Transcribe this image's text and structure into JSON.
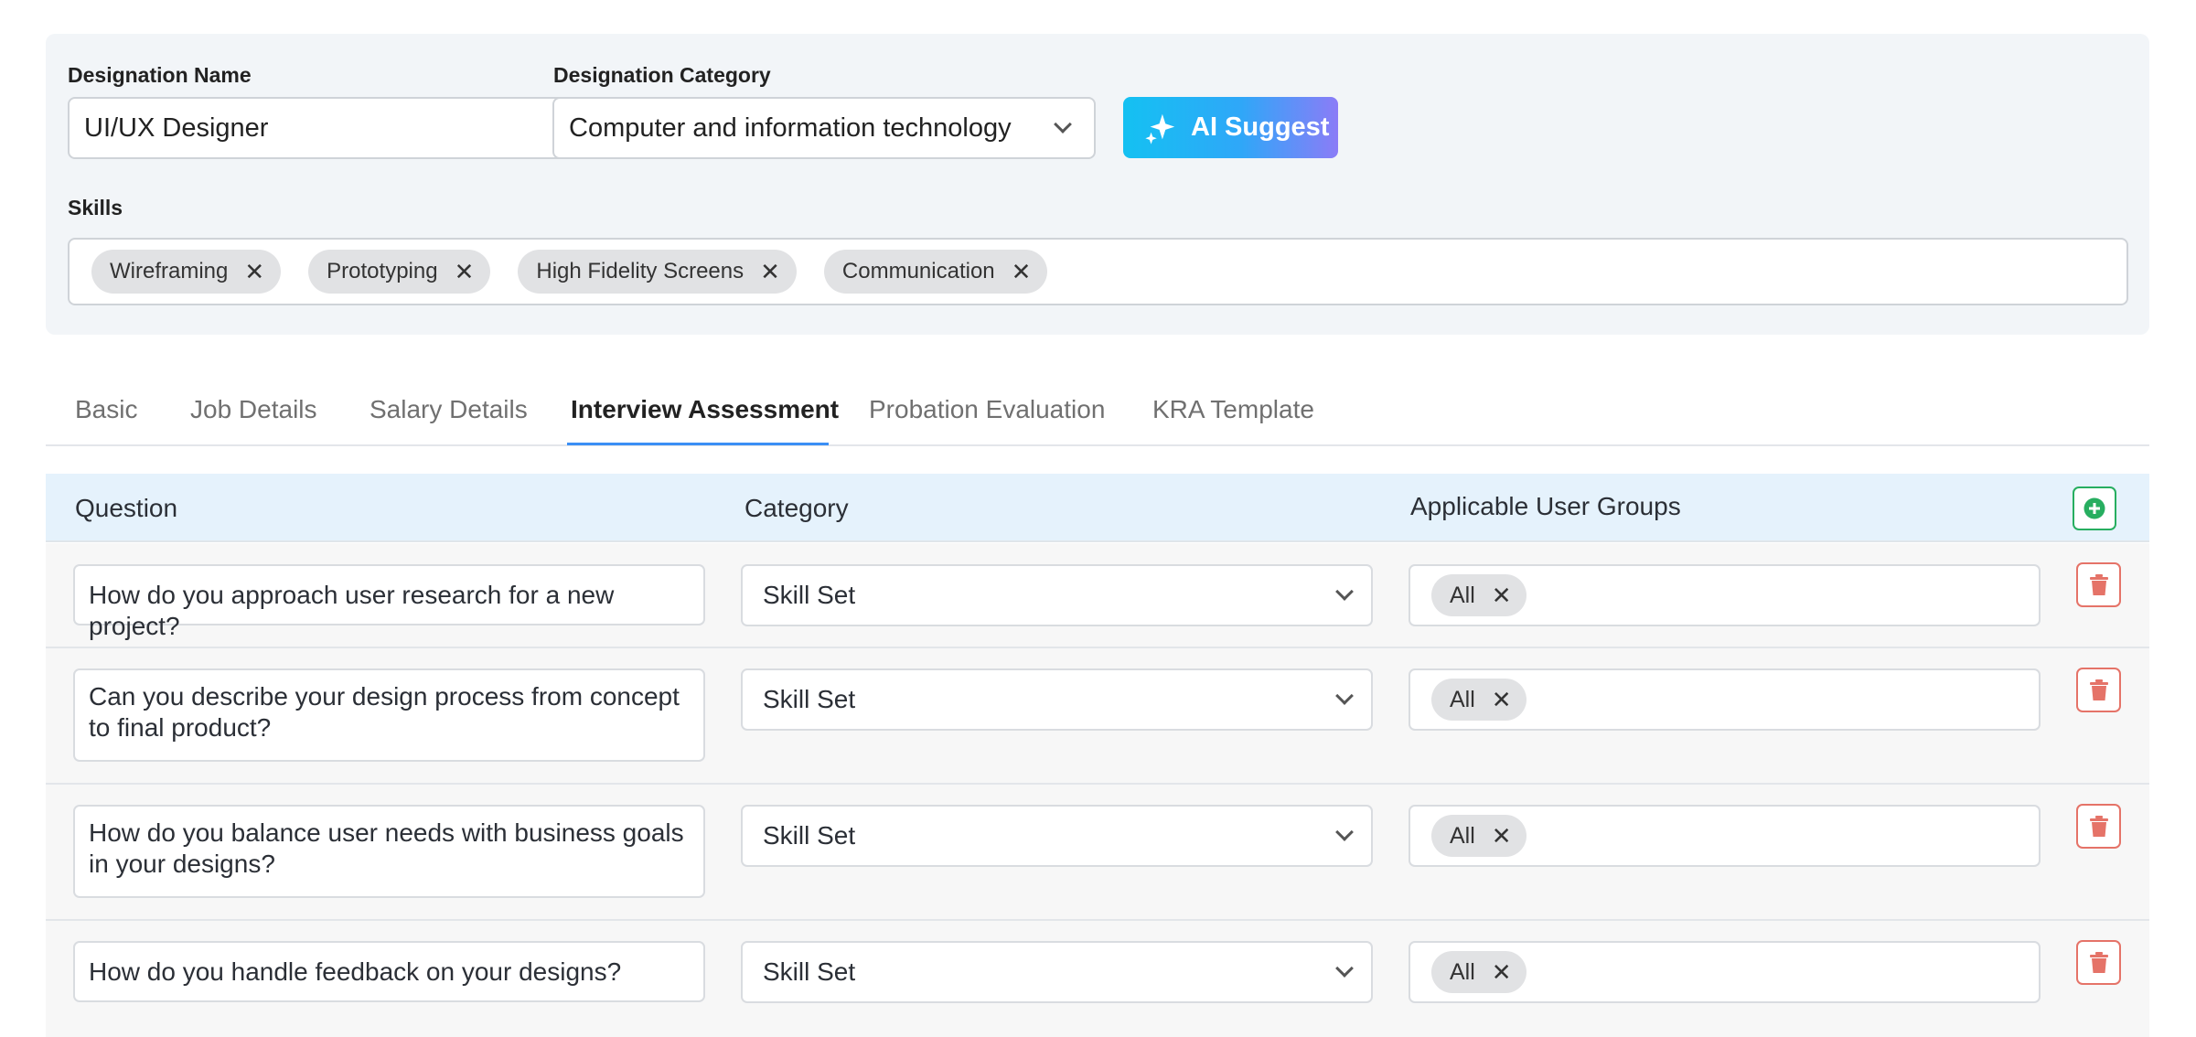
{
  "form": {
    "designation_name_label": "Designation Name",
    "designation_name_value": "UI/UX Designer",
    "designation_category_label": "Designation Category",
    "designation_category_value": "Computer and information technology",
    "ai_suggest_label": "AI Suggest",
    "skills_label": "Skills",
    "skills": [
      "Wireframing",
      "Prototyping",
      "High Fidelity Screens",
      "Communication"
    ]
  },
  "tabs": [
    "Basic",
    "Job Details",
    "Salary Details",
    "Interview Assessment",
    "Probation Evaluation",
    "KRA Template"
  ],
  "active_tab": "Interview Assessment",
  "table": {
    "headers": {
      "question": "Question",
      "category": "Category",
      "groups": "Applicable User Groups"
    },
    "rows": [
      {
        "question": "How do you approach user research for a new project?",
        "category": "Skill Set",
        "groups": [
          "All"
        ]
      },
      {
        "question": "Can you describe your design process from concept to final product?",
        "category": "Skill Set",
        "groups": [
          "All"
        ]
      },
      {
        "question": "How do you balance user needs with business goals in your designs?",
        "category": "Skill Set",
        "groups": [
          "All"
        ]
      },
      {
        "question": "How do you handle feedback on your designs?",
        "category": "Skill Set",
        "groups": [
          "All"
        ]
      }
    ]
  },
  "icons": {
    "remove": "close-icon",
    "dropdown": "chevron-down-icon",
    "ai": "sparkle-icon",
    "add": "plus-circle-icon",
    "delete": "trash-icon"
  },
  "colors": {
    "accent": "#3a8ff5",
    "add_green": "#27ae60",
    "delete_red": "#e57368",
    "ai_gradient_start": "#14c1f2",
    "ai_gradient_end": "#8b7cf7"
  }
}
